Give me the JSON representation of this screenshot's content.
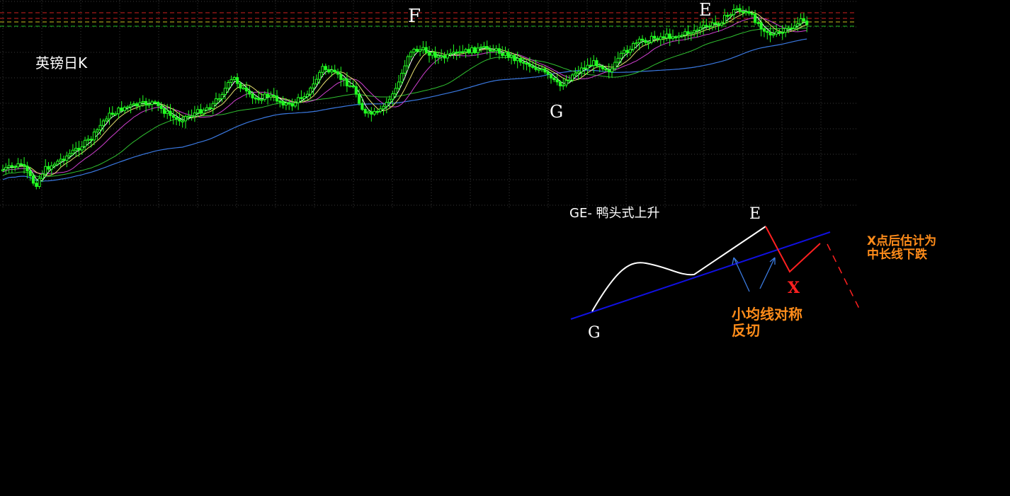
{
  "chart_data": [
    {
      "type": "candlestick",
      "title": "英镑日K",
      "annotations": [
        "F",
        "G",
        "E"
      ],
      "grid": true,
      "legend": "none",
      "colors": {
        "candle": "#22ff22",
        "ma_white": "#ffffff",
        "ma_yellow": "#e8e070",
        "ma_magenta": "#d040d0",
        "ma_green": "#30c030",
        "ma_blue": "#3a78e0",
        "hline_red": "#d02020",
        "hline_yellow": "#d0c020",
        "hline_green": "#20c020",
        "grid": "#3a3a3a"
      },
      "trend": "rising"
    },
    {
      "type": "diagram",
      "title": "GE- 鸭头式上升",
      "point_labels": {
        "start": "G",
        "peak": "E",
        "break": "X"
      },
      "annotations": [
        "小均线对称",
        "反切",
        "X点后估计为",
        "中长线下跌"
      ],
      "colors": {
        "trendline": "#1010e0",
        "path": "#ffffff",
        "break_path": "#ff2020",
        "arrows": "#3a7adf",
        "note": "#ff8c1a"
      }
    }
  ]
}
